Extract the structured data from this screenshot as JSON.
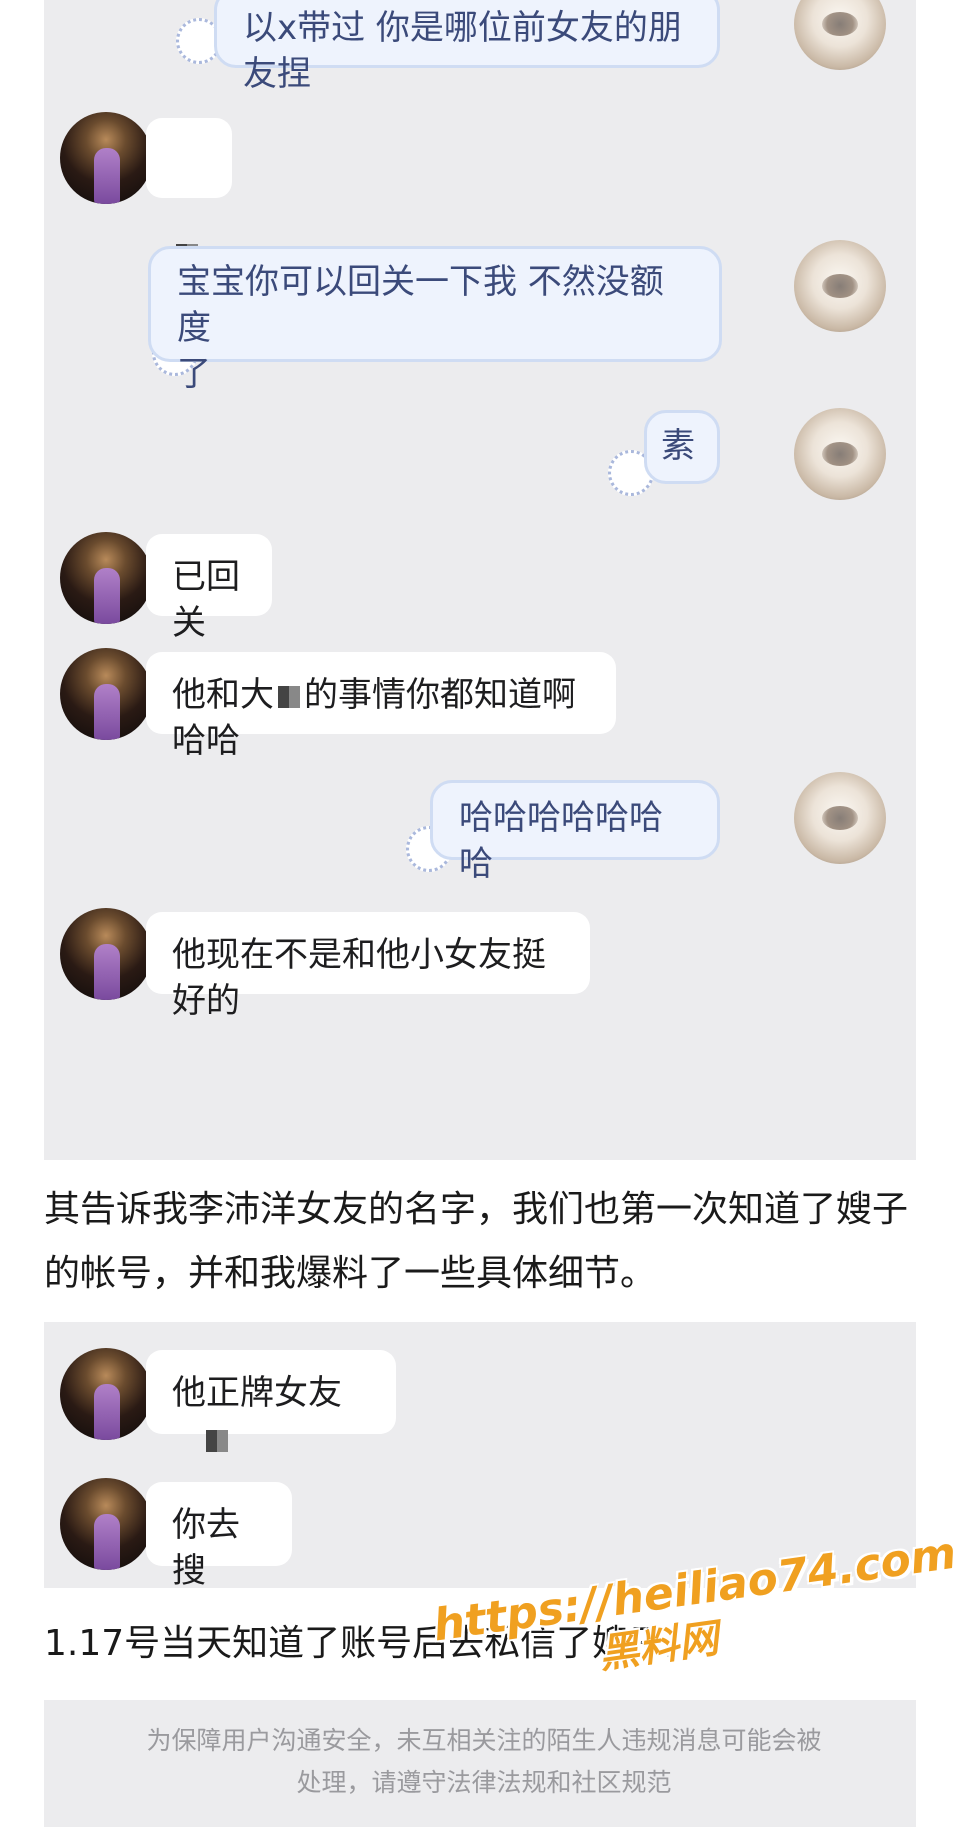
{
  "chat1": {
    "messages": [
      {
        "side": "right",
        "text": "以x带过 你是哪位前女友的朋友捏"
      },
      {
        "side": "left",
        "text": "",
        "redacted": true
      },
      {
        "side": "right",
        "text": "宝宝你可以回关一下我 不然没额度\n了"
      },
      {
        "side": "right",
        "text": "素"
      },
      {
        "side": "left",
        "text": "已回关"
      },
      {
        "side": "left",
        "text_before": "他和大",
        "text_after": "的事情你都知道啊哈哈"
      },
      {
        "side": "right",
        "text": "哈哈哈哈哈哈哈"
      },
      {
        "side": "left",
        "text": "他现在不是和他小女友挺好的"
      }
    ]
  },
  "caption1": "其告诉我李沛洋女友的名字，我们也第一次知道了嫂子的帐号，并和我爆料了一些具体细节。",
  "chat2": {
    "messages": [
      {
        "side": "left",
        "text": "他正牌女友"
      },
      {
        "side": "left",
        "text": "你去搜"
      }
    ]
  },
  "caption2": "1.17号当天知道了账号后去私信了嫂子。",
  "notice": {
    "text": "为保障用户沟通安全，未互相关注的陌生人违规消息可能会被处理，请遵守法律法规和社区规范"
  },
  "watermark": {
    "url": "https://heiliao74.com",
    "site": "黑料网"
  },
  "colors": {
    "panel_bg": "#ececee",
    "left_bubble": "#ffffff",
    "right_bubble": "#eef3fd",
    "right_bubble_border": "#cfdcf3",
    "watermark": "#f0a020"
  }
}
